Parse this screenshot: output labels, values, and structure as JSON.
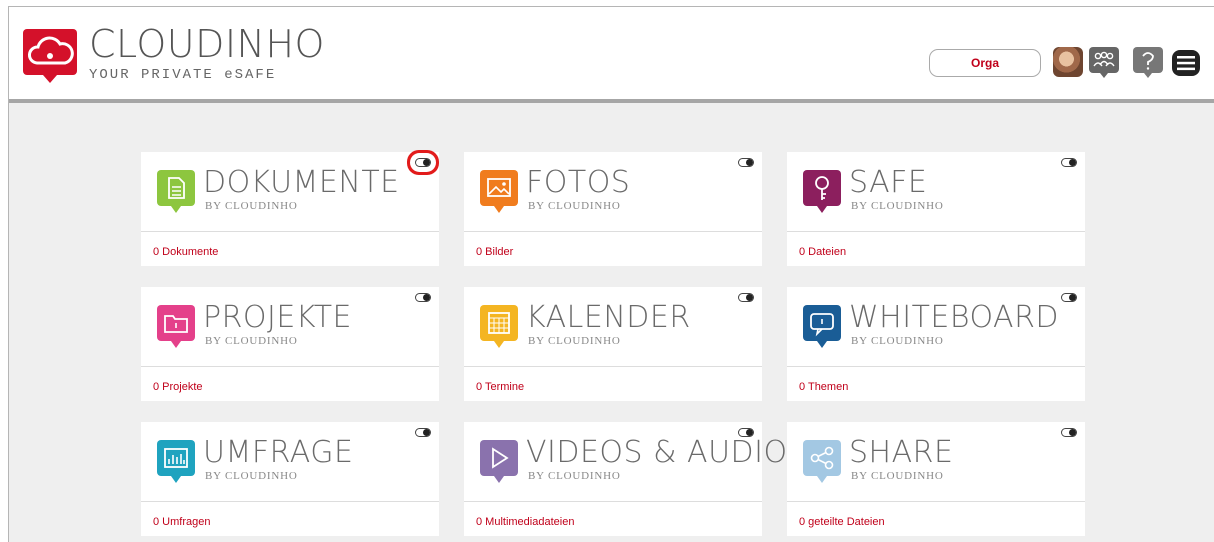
{
  "brand": {
    "title": "CLOUDINHO",
    "subtitle": "YOUR PRIVATE eSAFE"
  },
  "header": {
    "org_label": "Orga"
  },
  "tiles": [
    {
      "name": "DOKUMENTE",
      "by": "BY CLOUDINHO",
      "count": "0 Dokumente",
      "color": "#8dc63f",
      "icon": "document-icon"
    },
    {
      "name": "FOTOS",
      "by": "BY CLOUDINHO",
      "count": "0 Bilder",
      "color": "#f07c1e",
      "icon": "image-icon"
    },
    {
      "name": "SAFE",
      "by": "BY CLOUDINHO",
      "count": "0 Dateien",
      "color": "#8c1f5e",
      "icon": "key-icon"
    },
    {
      "name": "PROJEKTE",
      "by": "BY CLOUDINHO",
      "count": "0 Projekte",
      "color": "#e4408a",
      "icon": "folder-icon"
    },
    {
      "name": "KALENDER",
      "by": "BY CLOUDINHO",
      "count": "0 Termine",
      "color": "#f4b522",
      "icon": "calendar-icon"
    },
    {
      "name": "WHITEBOARD",
      "by": "BY CLOUDINHO",
      "count": "0 Themen",
      "color": "#1a5d96",
      "icon": "chat-icon"
    },
    {
      "name": "UMFRAGE",
      "by": "BY CLOUDINHO",
      "count": "0 Umfragen",
      "color": "#1fa3bf",
      "icon": "poll-chart-icon"
    },
    {
      "name": "VIDEOS & AUDIO",
      "by": "BY CLOUDINHO",
      "count": "0 Multimediadateien",
      "color": "#8a72ad",
      "icon": "play-icon"
    },
    {
      "name": "SHARE",
      "by": "BY CLOUDINHO",
      "count": "0 geteilte Dateien",
      "color": "#a3c8e3",
      "icon": "share-icon"
    }
  ]
}
